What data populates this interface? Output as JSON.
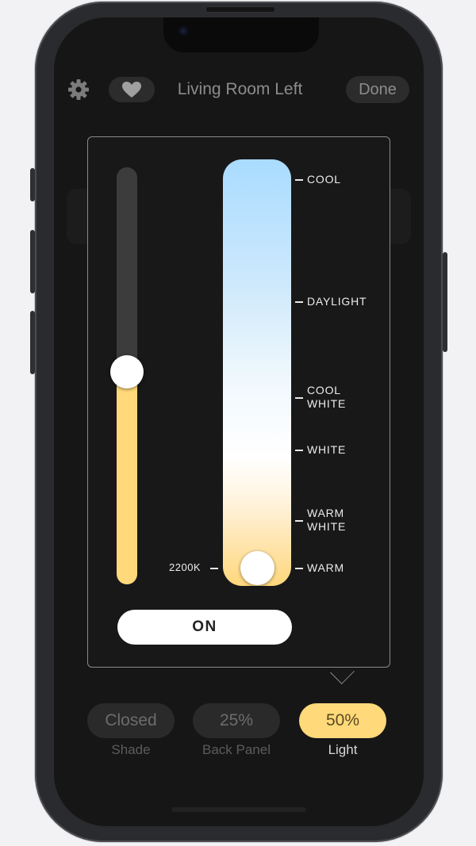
{
  "header": {
    "title": "Living Room Left",
    "done_label": "Done",
    "settings_icon": "gear-icon",
    "favorite_icon": "heart-icon"
  },
  "popup": {
    "brightness_level": 0.51,
    "temperature_level": 0.0,
    "kelvin_label": "2200K",
    "temperature_scale": [
      {
        "label_lines": [
          "COOL"
        ]
      },
      {
        "label_lines": [
          "DAYLIGHT"
        ]
      },
      {
        "label_lines": [
          "COOL",
          "WHITE"
        ]
      },
      {
        "label_lines": [
          "WHITE"
        ]
      },
      {
        "label_lines": [
          "WARM",
          "WHITE"
        ]
      },
      {
        "label_lines": [
          "WARM"
        ]
      }
    ],
    "power_label": "ON"
  },
  "devices": [
    {
      "value": "Closed",
      "name": "Shade",
      "active": false
    },
    {
      "value": "25%",
      "name": "Back Panel",
      "active": false
    },
    {
      "value": "50%",
      "name": "Light",
      "active": true
    }
  ],
  "colors": {
    "accent": "#ffd97a",
    "cool": "#a9dcff",
    "panel_bg": "#181818",
    "screen_bg": "#161616"
  }
}
